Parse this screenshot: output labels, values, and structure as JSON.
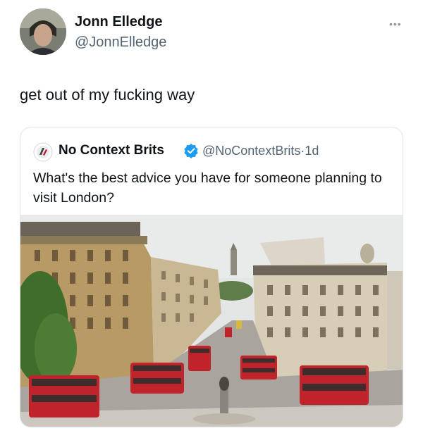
{
  "post": {
    "author_name": "Jonn Elledge",
    "author_handle": "@JonnElledge",
    "more_label": "•••",
    "text": "get out of my fucking way"
  },
  "quoted_post": {
    "author_name": "No Context Brits",
    "author_handle": "@NoContextBrits",
    "separator": "·",
    "time": "1d",
    "text": "What's the best advice you have for someone planning to visit London?",
    "verified_color": "#1d9bf0",
    "image_icon": "london-street-photo"
  },
  "colors": {
    "text": "#0f1419",
    "secondary": "#536471",
    "border": "#dfe3e6"
  }
}
